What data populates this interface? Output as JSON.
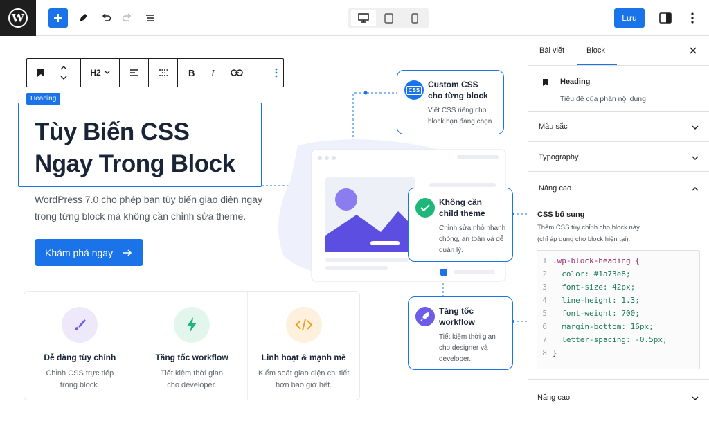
{
  "topbar": {
    "save_label": "Lưu"
  },
  "toolbar": {
    "heading_level": "H2"
  },
  "canvas": {
    "heading_tag": "Heading",
    "title_line1": "Tùy Biến CSS",
    "title_line2": "Ngay Trong Block",
    "desc_line1": "WordPress 7.0 cho phép bạn tùy biến giao diện ngay",
    "desc_line2": "trong từng block mà không cần chỉnh sửa theme.",
    "cta_label": "Khám phá ngay",
    "features": [
      {
        "title": "Dễ dàng tùy chỉnh",
        "desc1": "Chỉnh CSS trực tiếp",
        "desc2": "trong block.",
        "color": "#ede9fb",
        "icon": "brush-icon"
      },
      {
        "title": "Tăng tốc workflow",
        "desc1": "Tiết kiệm thời gian",
        "desc2": "cho developer.",
        "color": "#e3f6ee",
        "icon": "bolt-icon"
      },
      {
        "title": "Linh hoạt & mạnh mẽ",
        "desc1": "Kiểm soát giao diện chi tiết",
        "desc2": "hơn bao giờ hết.",
        "color": "#fdf0dc",
        "icon": "code-icon"
      }
    ],
    "callouts": [
      {
        "title1": "Custom CSS",
        "title2": "cho từng block",
        "d1": "Viết CSS riêng cho",
        "d2": "block bạn đang chọn.",
        "d3": "",
        "icon_text": "CSS"
      },
      {
        "title1": "Không cần",
        "title2": "child theme",
        "d1": "Chỉnh sửa nhỏ nhanh",
        "d2": "chóng, an toàn và dễ",
        "d3": "quản lý."
      },
      {
        "title1": "Tăng tốc",
        "title2": "workflow",
        "d1": "Tiết kiệm thời gian",
        "d2": "cho designer và",
        "d3": "developer."
      }
    ]
  },
  "sidebar": {
    "tab_post": "Bài viết",
    "tab_block": "Block",
    "block_name": "Heading",
    "block_desc": "Tiêu đề của phần nội dung.",
    "panel_color": "Màu sắc",
    "panel_typography": "Typography",
    "panel_advanced": "Nâng cao",
    "css_label": "CSS bổ sung",
    "css_help1": "Thêm CSS tùy chỉnh cho block này",
    "css_help2": "(chỉ áp dụng cho block hiện tại).",
    "code_lines": [
      ".wp-block-heading {",
      "  color: #1a73e8;",
      "  font-size: 42px;",
      "  line-height: 1.3;",
      "  font-weight: 700;",
      "  margin-bottom: 16px;",
      "  letter-spacing: -0.5px;",
      "}"
    ],
    "panel_advanced2": "Nâng cao"
  },
  "colors": {
    "accent": "#1a73e8",
    "dark": "#1e1e1e"
  }
}
